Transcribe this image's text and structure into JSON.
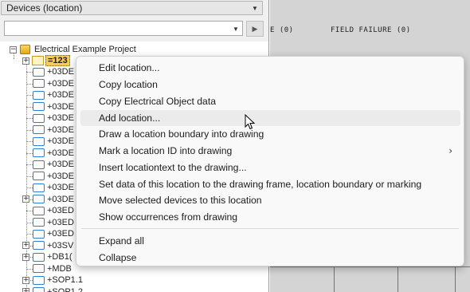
{
  "panel": {
    "view_selector": "Devices (location)",
    "filter_value": ""
  },
  "tree": {
    "root": "Electrical Example Project",
    "selected": "=123",
    "items": [
      "+03DE",
      "+03DE",
      "+03DE",
      "+03DE",
      "+03DE",
      "+03DE",
      "+03DE",
      "+03DE",
      "+03DE",
      "+03DE",
      "+03DE",
      "+03DE",
      "+03ED",
      "+03ED",
      "+03ED",
      "+03SV",
      "+DB1(",
      "+MDB",
      "+SOP1.1",
      "+SOP1.2"
    ]
  },
  "drawing": {
    "columns": [
      "E (0)",
      "FIELD FAILURE (0)"
    ]
  },
  "menu": {
    "items": [
      "Edit location...",
      "Copy location",
      "Copy Electrical Object data",
      "Add location...",
      "Draw a location boundary into drawing",
      "Mark a location ID into drawing",
      "Insert locationtext to the drawing...",
      "Set data of this location to the drawing frame, location boundary or marking",
      "Move selected devices to this location",
      "Show occurrences from drawing",
      "Expand all",
      "Collapse"
    ],
    "submenu_glyph": "›"
  }
}
